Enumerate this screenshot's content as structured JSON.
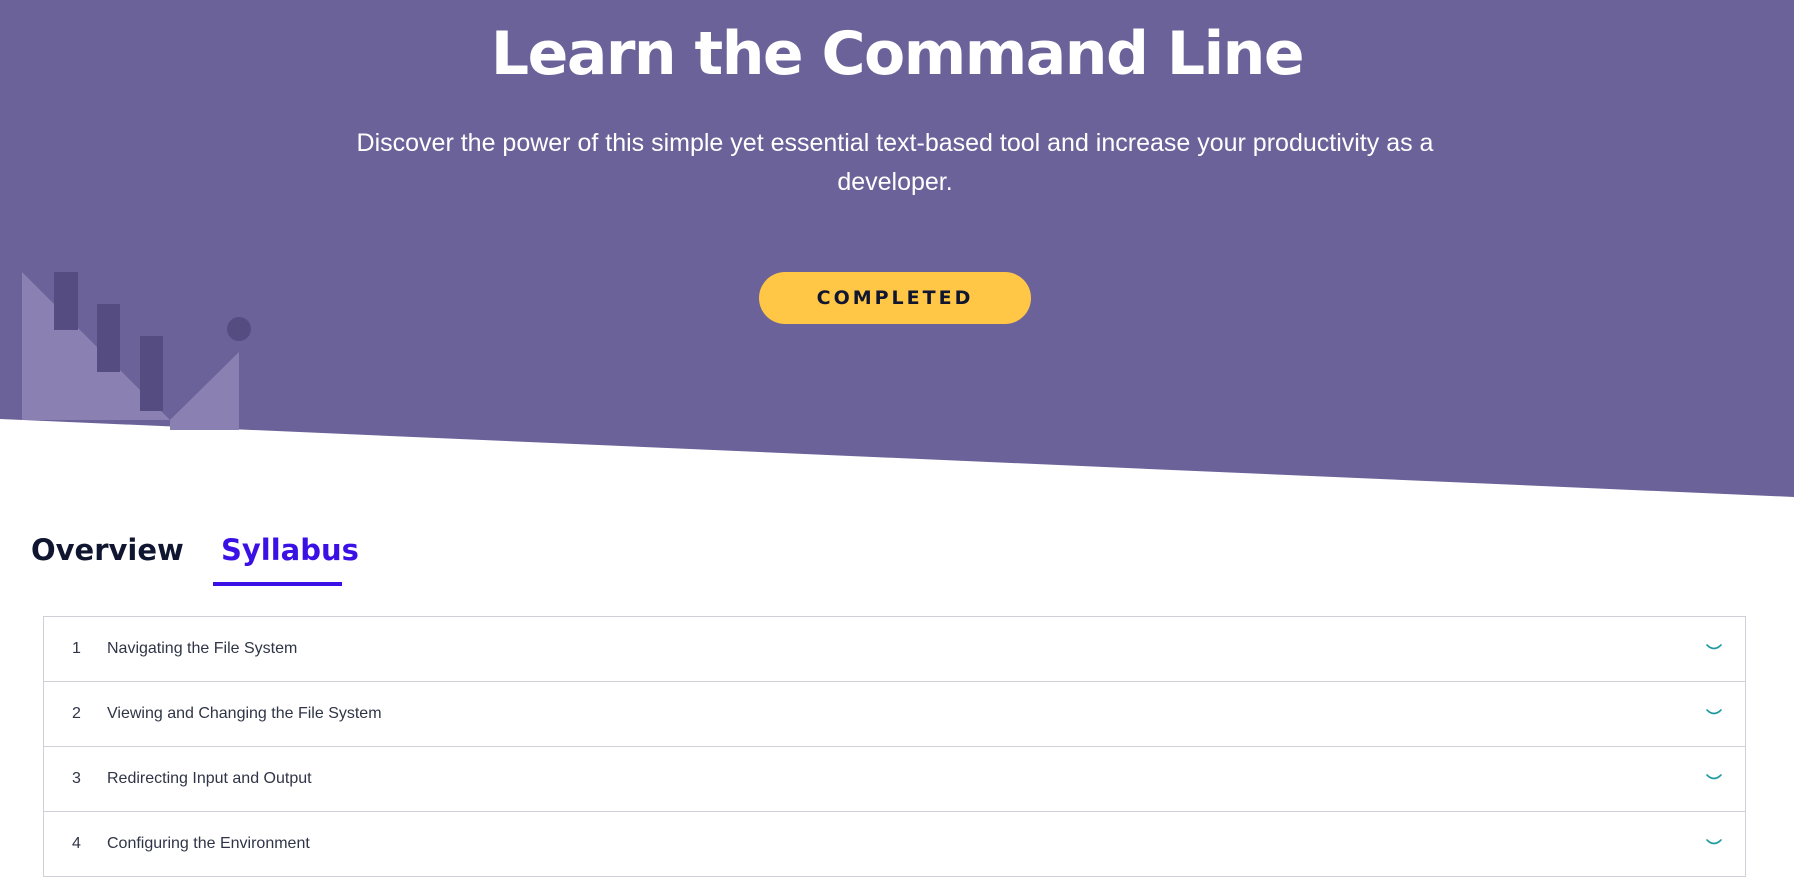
{
  "hero": {
    "title": "Learn the Command Line",
    "subtitle": "Discover the power of this simple yet essential text-based tool and increase your productivity as a developer.",
    "cta_label": "COMPLETED",
    "background_color": "#6b6299",
    "cta_color": "#ffc745"
  },
  "tabs": [
    {
      "label": "Overview",
      "active": false
    },
    {
      "label": "Syllabus",
      "active": true
    }
  ],
  "accent_color": "#3a10e5",
  "syllabus": {
    "modules": [
      {
        "number": "1",
        "title": "Navigating the File System",
        "icon": "chevron-down-icon"
      },
      {
        "number": "2",
        "title": "Viewing and Changing the File System",
        "icon": "chevron-down-icon"
      },
      {
        "number": "3",
        "title": "Redirecting Input and Output",
        "icon": "chevron-down-icon"
      },
      {
        "number": "4",
        "title": "Configuring the Environment",
        "icon": "chevron-down-icon"
      }
    ]
  }
}
